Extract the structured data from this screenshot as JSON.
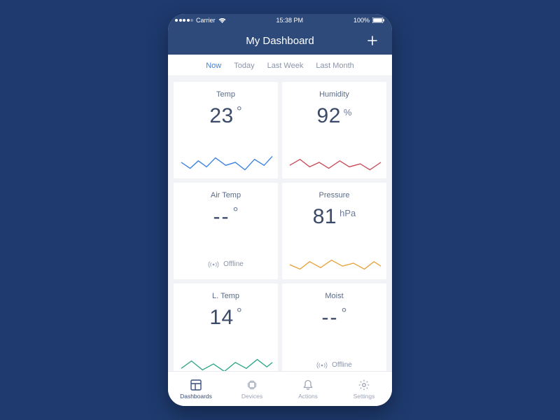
{
  "status": {
    "carrier": "Carrier",
    "time": "15:38 PM",
    "battery": "100%"
  },
  "header": {
    "title": "My Dashboard"
  },
  "tabs": {
    "items": [
      {
        "label": "Now",
        "active": true
      },
      {
        "label": "Today",
        "active": false
      },
      {
        "label": "Last Week",
        "active": false
      },
      {
        "label": "Last Month",
        "active": false
      }
    ]
  },
  "cards": [
    {
      "title": "Temp",
      "value": "23",
      "unit": "°",
      "offline": false,
      "spark_color": "#3b82e0"
    },
    {
      "title": "Humidity",
      "value": "92",
      "unit": "%",
      "offline": false,
      "spark_color": "#c94b5a"
    },
    {
      "title": "Air Temp",
      "value": "--",
      "unit": "°",
      "offline": true,
      "offline_label": "Offline"
    },
    {
      "title": "Pressure",
      "value": "81",
      "unit": "hPa",
      "offline": false,
      "spark_color": "#e8a23a"
    },
    {
      "title": "L. Temp",
      "value": "14",
      "unit": "°",
      "offline": false,
      "spark_color": "#2fa58a"
    },
    {
      "title": "Moist",
      "value": "--",
      "unit": "°",
      "offline": true,
      "offline_label": "Offline"
    }
  ],
  "nav": {
    "items": [
      {
        "label": "Dashboards",
        "active": true
      },
      {
        "label": "Devices",
        "active": false
      },
      {
        "label": "Actions",
        "active": false
      },
      {
        "label": "Settings",
        "active": false
      }
    ]
  }
}
